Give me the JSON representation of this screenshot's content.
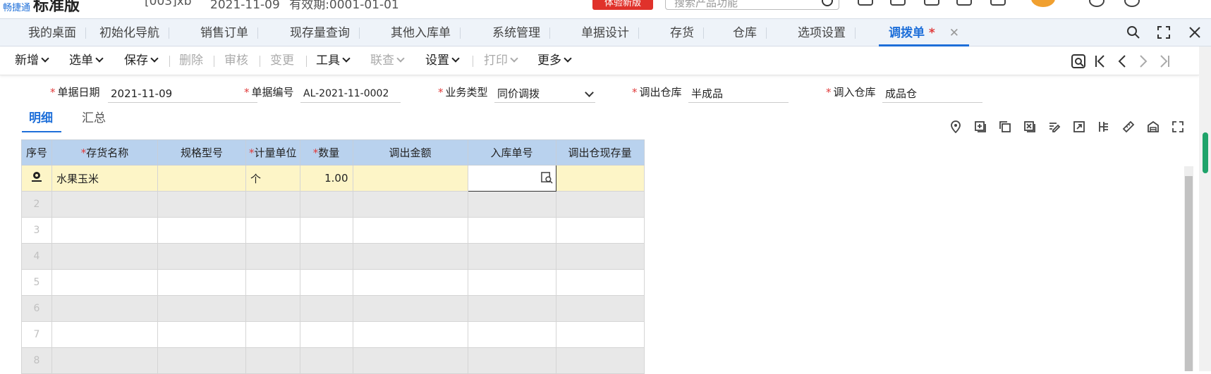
{
  "topbar": {
    "brand_small": "畅捷通",
    "brand_big": "标准版",
    "account": "[003]xb",
    "date_text": "2021-11-09",
    "period_text": "有效期:0001-01-01",
    "trial_button": "体验新版",
    "search_placeholder": "搜索产品功能"
  },
  "tabs": [
    {
      "label": "我的桌面"
    },
    {
      "label": "初始化导航"
    },
    {
      "label": "销售订单"
    },
    {
      "label": "现存量查询"
    },
    {
      "label": "其他入库单"
    },
    {
      "label": "系统管理"
    },
    {
      "label": "单据设计"
    },
    {
      "label": "存货"
    },
    {
      "label": "仓库"
    },
    {
      "label": "选项设置"
    },
    {
      "label": "调拨单",
      "star": "*",
      "close": "✕"
    }
  ],
  "toolbar": {
    "new": "新增",
    "select": "选单",
    "save": "保存",
    "delete": "删除",
    "audit": "审核",
    "change": "变更",
    "tools": "工具",
    "linked": "联查",
    "settings": "设置",
    "print": "打印",
    "more": "更多"
  },
  "form": {
    "date_label": "单据日期",
    "date_value": "2021-11-09",
    "code_label": "单据编号",
    "code_value": "AL-2021-11-0002",
    "biz_label": "业务类型",
    "biz_value": "同价调拨",
    "out_label": "调出仓库",
    "out_value": "半成品",
    "in_label": "调入仓库",
    "in_value": "成品仓",
    "required_mark": "*"
  },
  "subtabs": {
    "detail": "明细",
    "summary": "汇总"
  },
  "grid": {
    "headers": {
      "seq": "序号",
      "name": "存货名称",
      "spec": "规格型号",
      "unit": "计量单位",
      "qty": "数量",
      "amount": "调出金额",
      "in_no": "入库单号",
      "stock": "调出仓现存量"
    },
    "rows": [
      {
        "idx": "",
        "name": "水果玉米",
        "spec": "",
        "unit": "个",
        "qty": "1.00",
        "amount": "",
        "in_no": "",
        "stock": ""
      },
      {
        "idx": "2",
        "name": "",
        "spec": "",
        "unit": "",
        "qty": "",
        "amount": "",
        "in_no": "",
        "stock": ""
      },
      {
        "idx": "3",
        "name": "",
        "spec": "",
        "unit": "",
        "qty": "",
        "amount": "",
        "in_no": "",
        "stock": ""
      },
      {
        "idx": "4",
        "name": "",
        "spec": "",
        "unit": "",
        "qty": "",
        "amount": "",
        "in_no": "",
        "stock": ""
      },
      {
        "idx": "5",
        "name": "",
        "spec": "",
        "unit": "",
        "qty": "",
        "amount": "",
        "in_no": "",
        "stock": ""
      },
      {
        "idx": "6",
        "name": "",
        "spec": "",
        "unit": "",
        "qty": "",
        "amount": "",
        "in_no": "",
        "stock": ""
      },
      {
        "idx": "7",
        "name": "",
        "spec": "",
        "unit": "",
        "qty": "",
        "amount": "",
        "in_no": "",
        "stock": ""
      },
      {
        "idx": "8",
        "name": "",
        "spec": "",
        "unit": "",
        "qty": "",
        "amount": "",
        "in_no": "",
        "stock": ""
      }
    ]
  },
  "colors": {
    "accent": "#1e6fd9",
    "header_bg": "#b9d2ee",
    "selected_row": "#fdf5c7",
    "required": "#e03b3b"
  },
  "icons": {
    "nav": [
      "preview-icon",
      "first-page-icon",
      "prev-page-icon",
      "next-page-icon",
      "last-page-icon"
    ],
    "grid_tools": [
      "locate-icon",
      "add-row-icon",
      "copy-row-icon",
      "delete-row-icon",
      "edit-icon",
      "export-icon",
      "split-icon",
      "measure-icon",
      "warehouse-icon",
      "fullscreen-icon"
    ]
  }
}
